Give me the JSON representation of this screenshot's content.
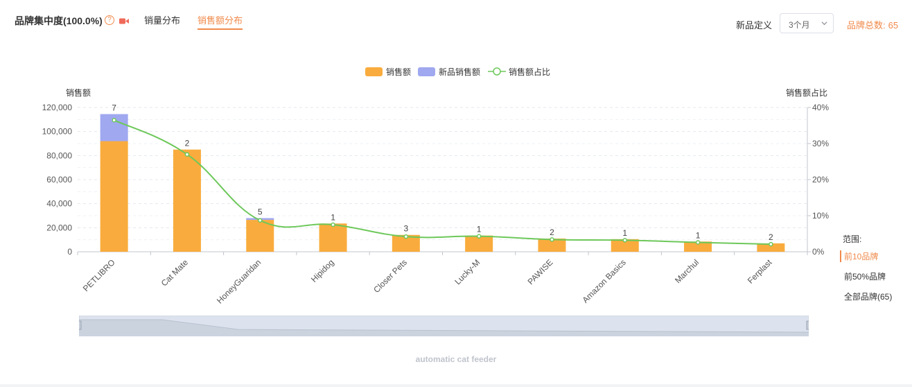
{
  "header": {
    "title": "品牌集中度(100.0%)",
    "help_icon": "question-circle-icon",
    "video_icon": "video-camera-icon",
    "tabs": [
      {
        "label": "销量分布",
        "active": false
      },
      {
        "label": "销售额分布",
        "active": true
      }
    ],
    "new_product_label": "新品定义",
    "select_value": "3个月",
    "total_label": "品牌总数:",
    "total_value": "65"
  },
  "colors": {
    "accent": "#f08a4b",
    "sales_bar": "#f9ac3d",
    "new_sales_bar": "#a0a8f0",
    "ratio_line": "#6dc85a"
  },
  "legend": {
    "sales": "销售额",
    "new_sales": "新品销售额",
    "ratio": "销售额占比"
  },
  "chart_data": {
    "type": "bar",
    "left_axis_title": "销售额",
    "right_axis_title": "销售额占比",
    "categories": [
      "PETLIBRO",
      "Cat Mate",
      "HoneyGuaridan",
      "Hipidog",
      "Closer Pets",
      "Lucky-M",
      "PAWISE",
      "Amazon Basics",
      "Marchul",
      "Ferplast"
    ],
    "series": [
      {
        "name": "销售额",
        "type": "bar",
        "stack": "total",
        "values": [
          92000,
          85000,
          26500,
          23500,
          14000,
          13500,
          11000,
          10500,
          8500,
          7000
        ]
      },
      {
        "name": "新品销售额",
        "type": "bar",
        "stack": "total",
        "values": [
          22500,
          0,
          1500,
          0,
          0,
          0,
          0,
          0,
          0,
          0
        ]
      },
      {
        "name": "销售额占比",
        "type": "line",
        "axis": "right",
        "values": [
          36.5,
          27,
          8.7,
          7.5,
          4.2,
          4.3,
          3.4,
          3.2,
          2.6,
          2.1
        ]
      }
    ],
    "bar_labels": [
      "7",
      "2",
      "5",
      "1",
      "3",
      "1",
      "2",
      "1",
      "1",
      "2"
    ],
    "y_left": {
      "min": 0,
      "max": 120000,
      "ticks": [
        "0",
        "20,000",
        "40,000",
        "60,000",
        "80,000",
        "100,000",
        "120,000"
      ]
    },
    "y_right": {
      "min": 0,
      "max": 40,
      "ticks": [
        "0%",
        "10%",
        "20%",
        "30%",
        "40%"
      ]
    },
    "grid": true,
    "legend_position": "top-center"
  },
  "range": {
    "title": "范围:",
    "options": [
      {
        "label": "前10品牌",
        "active": true
      },
      {
        "label": "前50%品牌",
        "active": false
      },
      {
        "label": "全部品牌(65)",
        "active": false
      }
    ]
  },
  "caption": "automatic cat feeder"
}
